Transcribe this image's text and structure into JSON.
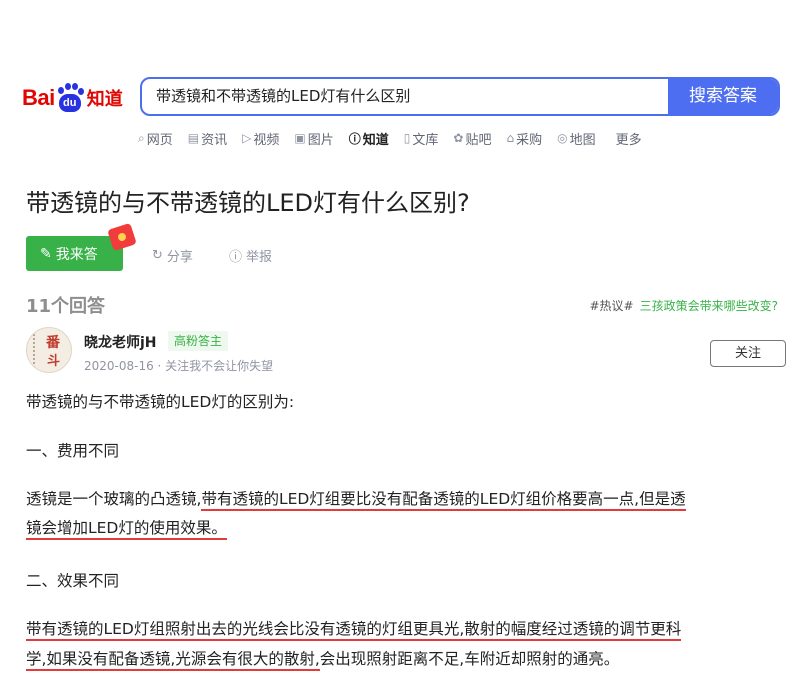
{
  "logo": {
    "bai": "Bai",
    "du": "du",
    "zhidao": "知道"
  },
  "search": {
    "query": "带透镜和不带透镜的LED灯有什么区别",
    "button": "搜索答案"
  },
  "nav": {
    "items": [
      {
        "label": "网页",
        "icon": "search-icon"
      },
      {
        "label": "资讯",
        "icon": "news-icon"
      },
      {
        "label": "视频",
        "icon": "video-icon"
      },
      {
        "label": "图片",
        "icon": "image-icon"
      },
      {
        "label": "知道",
        "icon": "question-icon"
      },
      {
        "label": "文库",
        "icon": "doc-icon"
      },
      {
        "label": "贴吧",
        "icon": "tieba-icon"
      },
      {
        "label": "采购",
        "icon": "purchase-icon"
      },
      {
        "label": "地图",
        "icon": "map-icon"
      }
    ],
    "more": "更多"
  },
  "question": {
    "title": "带透镜的与不带透镜的LED灯有什么区别?"
  },
  "actions": {
    "answer": "我来答",
    "share": "分享",
    "report": "举报"
  },
  "answers": {
    "count": "11个回答"
  },
  "hot": {
    "tag": "#热议#",
    "link": "三孩政策会带来哪些改变?"
  },
  "answer": {
    "avatar_text_1": "番",
    "avatar_text_2": "斗",
    "author": "晓龙老师jH",
    "badge": "高粉答主",
    "meta": "2020-08-16 · 关注我不会让你失望",
    "follow": "关注",
    "paragraphs": {
      "intro": "带透镜的与不带透镜的LED灯的区别为:",
      "h1": "一、费用不同",
      "p1_a": "透镜是一个玻璃的凸透镜,",
      "p1_b": "带有透镜的LED灯组要比没有配备透镜的LED灯组价格要高一点,但是透",
      "p1_c": "镜会增加LED灯的使用效果。",
      "h2": "二、效果不同",
      "p2_a": "带有透镜的LED灯组照射出去的光线会比没有透镜的灯组更具光,散射的幅度经过透镜的调节更科",
      "p2_b": "学,如果没有配备透镜,光源会有很大的散射,",
      "p2_c": "会出现照射距离不足,车附近却照射的通亮。"
    }
  },
  "colors": {
    "brand_blue": "#4e6ef2",
    "green": "#38b248",
    "underline_red": "#e33a3a",
    "logo_red": "#e10601"
  }
}
